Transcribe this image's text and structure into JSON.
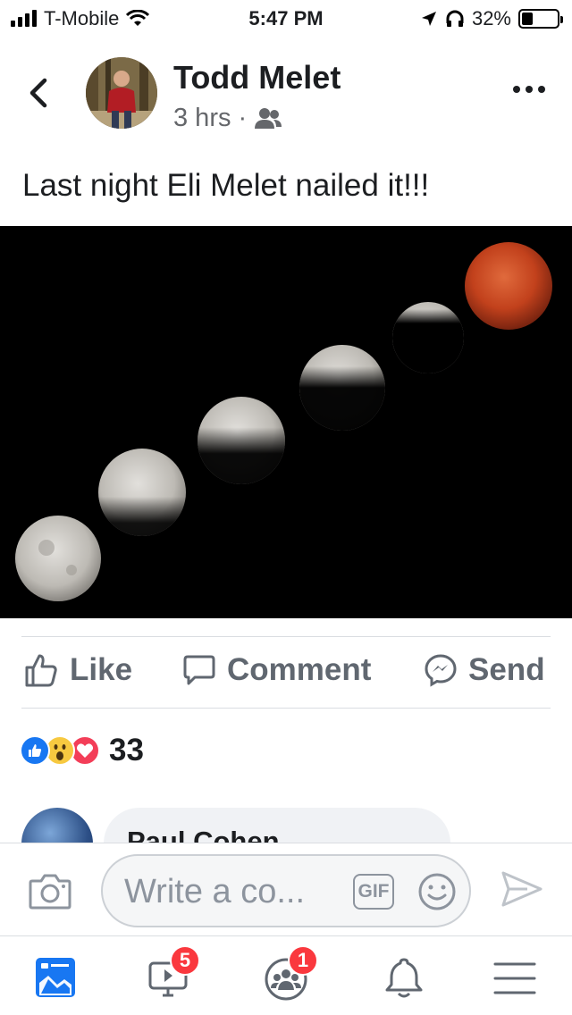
{
  "status_bar": {
    "carrier": "T-Mobile",
    "time": "5:47 PM",
    "battery": "32%",
    "battery_level": 0.32,
    "icons": [
      "signal-icon",
      "wifi-icon",
      "location-icon",
      "headphones-icon",
      "battery-icon"
    ]
  },
  "post": {
    "author": "Todd Melet",
    "time": "3 hrs",
    "separator": "·",
    "audience_icon": "friends-icon",
    "text": "Last night Eli Melet nailed it!!!"
  },
  "actions": {
    "like": "Like",
    "comment": "Comment",
    "send": "Send"
  },
  "reactions": {
    "types": [
      "like",
      "wow",
      "love"
    ],
    "count": "33"
  },
  "comment_preview": {
    "name": "Paul Cohen"
  },
  "composer": {
    "placeholder": "Write a co...",
    "gif": "GIF"
  },
  "tab_bar": {
    "items": [
      {
        "name": "news-feed",
        "badge": ""
      },
      {
        "name": "watch",
        "badge": "5"
      },
      {
        "name": "groups",
        "badge": "1"
      },
      {
        "name": "notifications",
        "badge": ""
      },
      {
        "name": "menu",
        "badge": ""
      }
    ]
  },
  "colors": {
    "facebook_blue": "#1877f2",
    "like_blue": "#1877f2",
    "love_red": "#f33e58",
    "badge_red": "#fa383e"
  }
}
